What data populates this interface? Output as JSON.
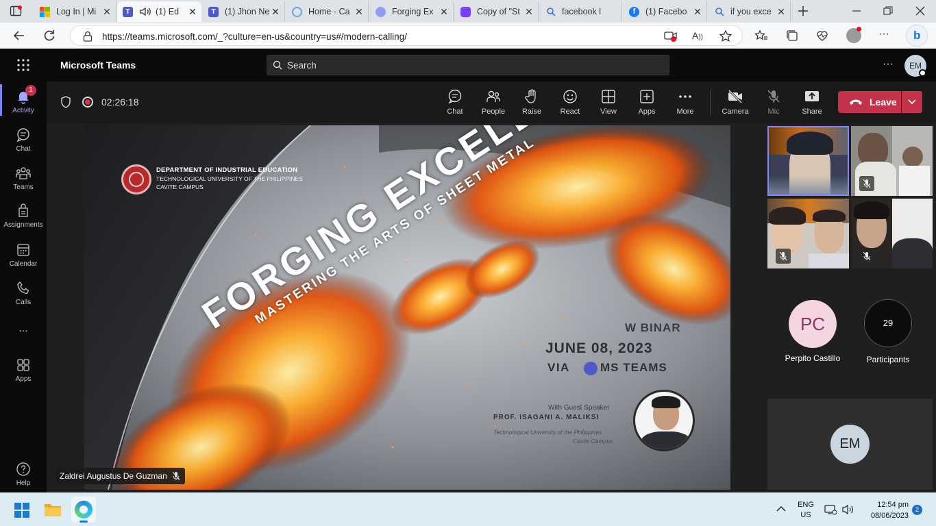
{
  "browser": {
    "tabs": [
      {
        "title": "Log In | Mi",
        "favicon_color": "#f25022"
      },
      {
        "title": "(1) Ed",
        "favicon_color": "#5059c9"
      },
      {
        "title": "(1) Jhon Ne",
        "favicon_color": "#5059c9"
      },
      {
        "title": "Home - Ca",
        "favicon_color": "#6aa3d8"
      },
      {
        "title": "Forging Ex",
        "favicon_color": "#8b9ef0"
      },
      {
        "title": "Copy of \"St",
        "favicon_color": "#7b3ff2"
      },
      {
        "title": "facebook l",
        "favicon_color": "#3b6fd6"
      },
      {
        "title": "(1) Facebo",
        "favicon_color": "#1877f2"
      },
      {
        "title": "if you exce",
        "favicon_color": "#3b6fd6"
      }
    ],
    "url": "https://teams.microsoft.com/_?culture=en-us&country=us#/modern-calling/"
  },
  "teams": {
    "app_title": "Microsoft Teams",
    "search_placeholder": "Search",
    "user_initials": "EM"
  },
  "rail": {
    "items": [
      {
        "label": "Activity",
        "badge": "1"
      },
      {
        "label": "Chat"
      },
      {
        "label": "Teams"
      },
      {
        "label": "Assignments"
      },
      {
        "label": "Calendar"
      },
      {
        "label": "Calls"
      },
      {
        "label": "..."
      },
      {
        "label": "Apps"
      }
    ],
    "help_label": "Help"
  },
  "call": {
    "timer": "02:26:18",
    "buttons": {
      "chat": "Chat",
      "people": "People",
      "raise": "Raise",
      "react": "React",
      "view": "View",
      "apps": "Apps",
      "more": "More",
      "camera": "Camera",
      "mic": "Mic",
      "share": "Share"
    },
    "leave_label": "Leave",
    "presenter_name": "Zaldrei Augustus De Guzman"
  },
  "slide": {
    "department": "DEPARTMENT OF INDUSTRIAL EDUCATION",
    "university": "TECHNOLOGICAL UNIVERSITY OF THE PHILIPPINES",
    "campus": "CAVITE CAMPUS",
    "title": "FORGING EXCELLENCE",
    "subtitle": "MASTERING THE ARTS OF SHEET METAL",
    "event_type": "W BINAR",
    "date": "JUNE 08, 2023",
    "via": "VIA",
    "platform": "MS TEAMS",
    "guest_intro": "With Guest Speaker",
    "speaker_name": "PROF. ISAGANI A. MALIKSI",
    "speaker_org": "Technological University of the Philippines",
    "speaker_campus": "Cavite Campus"
  },
  "participants_panel": {
    "named": {
      "initials": "PC",
      "name": "Perpito Castillo"
    },
    "count": "29",
    "count_label": "Participants",
    "self_initials": "EM"
  },
  "taskbar": {
    "lang": "ENG",
    "region": "US",
    "time": "12:54 pm",
    "date": "08/06/2023",
    "notifications": "2"
  }
}
